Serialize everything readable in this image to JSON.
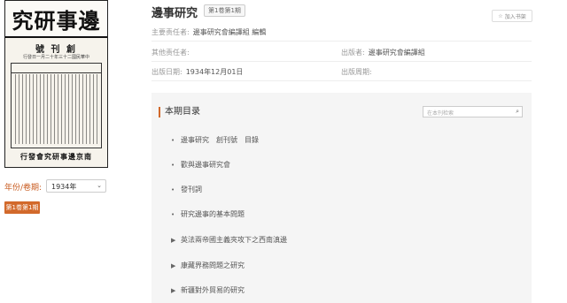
{
  "cover": {
    "title": "究研事邊",
    "issue": "號 刊 創",
    "date": "行發日一月二十年三十二國民華中",
    "footer": "行發會究研事邊京南"
  },
  "filter": {
    "year_label": "年份/卷期:",
    "year_value": "1934年",
    "issue_button": "第1卷第1期"
  },
  "header": {
    "title": "邊事研究",
    "volume_badge": "第1卷第1期",
    "favorite_label": "加入书架"
  },
  "meta": {
    "main_resp_label": "主要责任者:",
    "main_resp_value": "邊事研究會編譯組 編輯",
    "other_resp_label": "其他责任者:",
    "publisher_label": "出版者:",
    "publisher_value": "邊事研究會編譯組",
    "date_label": "出版日期:",
    "date_value": "1934年12月01日",
    "cycle_label": "出版周期:"
  },
  "toc": {
    "heading": "本期目录",
    "search_placeholder": "在本刊检索",
    "items": [
      {
        "marker": "•",
        "label": "邊事研究　創刊號　目錄"
      },
      {
        "marker": "•",
        "label": "歡與邊事研究會"
      },
      {
        "marker": "•",
        "label": "發刊詞"
      },
      {
        "marker": "•",
        "label": "研究邊事的基本問題"
      },
      {
        "marker": "▶",
        "label": "英法兩帝國主義夾攻下之西南滇邊"
      },
      {
        "marker": "▶",
        "label": "康藏界務問題之研究"
      },
      {
        "marker": "▶",
        "label": "新疆對外貿易的研究"
      }
    ]
  },
  "colors": {
    "accent": "#d2692b"
  }
}
